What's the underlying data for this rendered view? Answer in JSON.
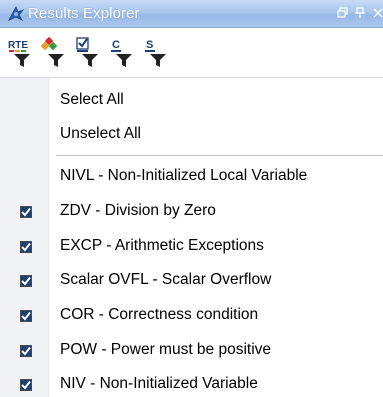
{
  "window": {
    "title": "Results Explorer",
    "controls": [
      "restore-icon",
      "pin-icon",
      "close-icon"
    ]
  },
  "toolbar": {
    "buttons": [
      {
        "icon": "rte-filter-icon",
        "text": "RTE"
      },
      {
        "icon": "color-filter-icon",
        "text": ""
      },
      {
        "icon": "checked-filter-icon",
        "text": ""
      },
      {
        "icon": "c-filter-icon",
        "text": "C"
      },
      {
        "icon": "s-filter-icon",
        "text": "S"
      }
    ]
  },
  "menu": {
    "select_all": "Select All",
    "unselect_all": "Unselect All",
    "items": [
      {
        "label": "NIVL - Non-Initialized Local Variable",
        "checked": false
      },
      {
        "label": "ZDV - Division by Zero",
        "checked": true
      },
      {
        "label": "EXCP - Arithmetic Exceptions",
        "checked": true
      },
      {
        "label": "Scalar OVFL - Scalar Overflow",
        "checked": true
      },
      {
        "label": "COR - Correctness condition",
        "checked": true
      },
      {
        "label": "POW - Power must be positive",
        "checked": true
      },
      {
        "label": "NIV - Non-Initialized Variable",
        "checked": true
      }
    ]
  },
  "colors": {
    "titlebar": "#a9c6ec",
    "gutter": "#f0f2f5",
    "check_fill": "#1f3e73"
  }
}
